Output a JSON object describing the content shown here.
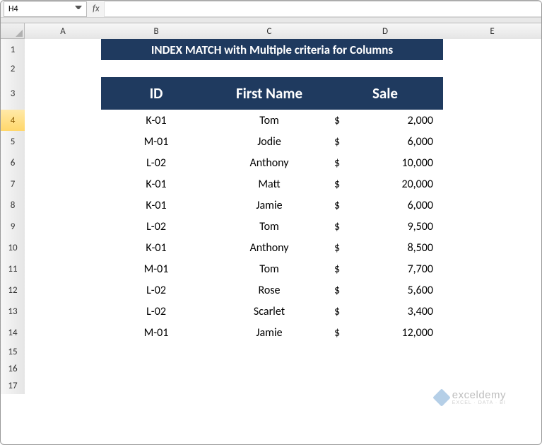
{
  "namebox": "H4",
  "fx_label": "fx",
  "formula_value": "",
  "col_headers": [
    "A",
    "B",
    "C",
    "D",
    "E"
  ],
  "rows_visible": [
    1,
    2,
    3,
    4,
    5,
    6,
    7,
    8,
    9,
    10,
    11,
    12,
    13,
    14,
    15,
    16,
    17
  ],
  "active_row": 4,
  "title": "INDEX MATCH with Multiple criteria for Columns",
  "table": {
    "headers": [
      "ID",
      "First Name",
      "Sale"
    ],
    "rows": [
      {
        "id": "K-01",
        "name": "Tom",
        "sale": "2,000"
      },
      {
        "id": "M-01",
        "name": "Jodie",
        "sale": "6,000"
      },
      {
        "id": "L-02",
        "name": "Anthony",
        "sale": "10,000"
      },
      {
        "id": "K-01",
        "name": "Matt",
        "sale": "20,000"
      },
      {
        "id": "K-01",
        "name": "Jamie",
        "sale": "6,000"
      },
      {
        "id": "L-02",
        "name": "Tom",
        "sale": "9,500"
      },
      {
        "id": "K-01",
        "name": "Anthony",
        "sale": "8,500"
      },
      {
        "id": "M-01",
        "name": "Tom",
        "sale": "7,700"
      },
      {
        "id": "L-02",
        "name": "Rose",
        "sale": "5,600"
      },
      {
        "id": "L-02",
        "name": "Scarlet",
        "sale": "3,400"
      },
      {
        "id": "M-01",
        "name": "Jamie",
        "sale": "12,000"
      }
    ],
    "currency": "$"
  },
  "watermark": {
    "main": "exceldemy",
    "sub": "EXCEL · DATA · BI"
  }
}
